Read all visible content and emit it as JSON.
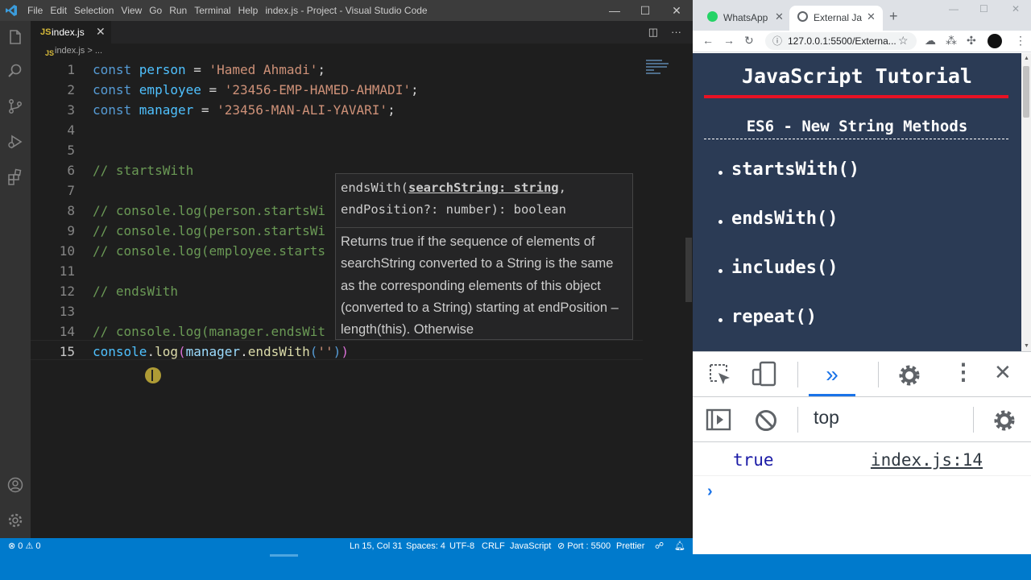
{
  "vscode": {
    "menu": [
      "File",
      "Edit",
      "Selection",
      "View",
      "Go",
      "Run",
      "Terminal",
      "Help"
    ],
    "window_title": "index.js - Project - Visual Studio Code",
    "tab": {
      "name": "index.js",
      "icon_text": "JS"
    },
    "breadcrumb": "index.js > ...",
    "lines": [
      {
        "num": "1",
        "tokens": [
          {
            "t": "const ",
            "c": "k"
          },
          {
            "t": "person",
            "c": "v"
          },
          {
            "t": " = ",
            "c": "d"
          },
          {
            "t": "'Hamed Ahmadi'",
            "c": "s"
          },
          {
            "t": ";",
            "c": "d"
          }
        ]
      },
      {
        "num": "2",
        "tokens": [
          {
            "t": "const ",
            "c": "k"
          },
          {
            "t": "employee",
            "c": "v"
          },
          {
            "t": " = ",
            "c": "d"
          },
          {
            "t": "'23456-EMP-HAMED-AHMADI'",
            "c": "s"
          },
          {
            "t": ";",
            "c": "d"
          }
        ]
      },
      {
        "num": "3",
        "tokens": [
          {
            "t": "const ",
            "c": "k"
          },
          {
            "t": "manager",
            "c": "v"
          },
          {
            "t": " = ",
            "c": "d"
          },
          {
            "t": "'23456-MAN-ALI-YAVARI'",
            "c": "s"
          },
          {
            "t": ";",
            "c": "d"
          }
        ]
      },
      {
        "num": "4",
        "tokens": []
      },
      {
        "num": "5",
        "tokens": []
      },
      {
        "num": "6",
        "tokens": [
          {
            "t": "// startsWith",
            "c": "c"
          }
        ]
      },
      {
        "num": "7",
        "tokens": []
      },
      {
        "num": "8",
        "tokens": [
          {
            "t": "// console.log(person.startsWi",
            "c": "c"
          }
        ]
      },
      {
        "num": "9",
        "tokens": [
          {
            "t": "// console.log(person.startsWi",
            "c": "c"
          }
        ]
      },
      {
        "num": "10",
        "tokens": [
          {
            "t": "// console.log(employee.starts",
            "c": "c"
          }
        ]
      },
      {
        "num": "11",
        "tokens": []
      },
      {
        "num": "12",
        "tokens": [
          {
            "t": "// endsWith",
            "c": "c"
          }
        ]
      },
      {
        "num": "13",
        "tokens": []
      },
      {
        "num": "14",
        "tokens": [
          {
            "t": "// console.log(manager.endsWit",
            "c": "c"
          }
        ]
      },
      {
        "num": "15",
        "tokens": [
          {
            "t": "console",
            "c": "v"
          },
          {
            "t": ".",
            "c": "d"
          },
          {
            "t": "log",
            "c": "f"
          },
          {
            "t": "(",
            "c": "p"
          },
          {
            "t": "manager",
            "c": "o"
          },
          {
            "t": ".",
            "c": "d"
          },
          {
            "t": "endsWith",
            "c": "f"
          },
          {
            "t": "(",
            "c": "k"
          },
          {
            "t": "''",
            "c": "s"
          },
          {
            "t": ")",
            "c": "k"
          },
          {
            "t": ")",
            "c": "p"
          }
        ]
      }
    ],
    "active_line": "15",
    "tooltip": {
      "sig_name": "endsWith(",
      "sig_param": "searchString: string",
      "sig_rest": ",",
      "sig_line2": "endPosition?: number): boolean",
      "doc": "Returns true if the sequence of elements of searchString converted to a String is the same as the corresponding elements of this object (converted to a String) starting at endPosition – length(this). Otherwise"
    },
    "status": {
      "problems": "⊗ 0 ⚠ 0",
      "position": "Ln 15, Col 31",
      "spaces": "Spaces: 4",
      "encoding": "UTF-8",
      "eol": "CRLF",
      "language": "JavaScript",
      "port": "⊘ Port : 5500",
      "prettier": "Prettier"
    }
  },
  "browser": {
    "tabs": [
      {
        "title": "WhatsApp"
      },
      {
        "title": "External Java"
      }
    ],
    "address": "127.0.0.1:5500/Externa...",
    "page": {
      "title": "JavaScript Tutorial",
      "subtitle": "ES6 - New String Methods",
      "methods": [
        "startsWith()",
        "endsWith()",
        "includes()",
        "repeat()"
      ]
    },
    "devtools": {
      "context": "top",
      "console_value": "true",
      "console_source": "index.js:14",
      "prompt": "›"
    }
  },
  "colors": {
    "accent": "#007acc",
    "page_bg": "#2b3b55",
    "red_rule": "#e81123"
  }
}
